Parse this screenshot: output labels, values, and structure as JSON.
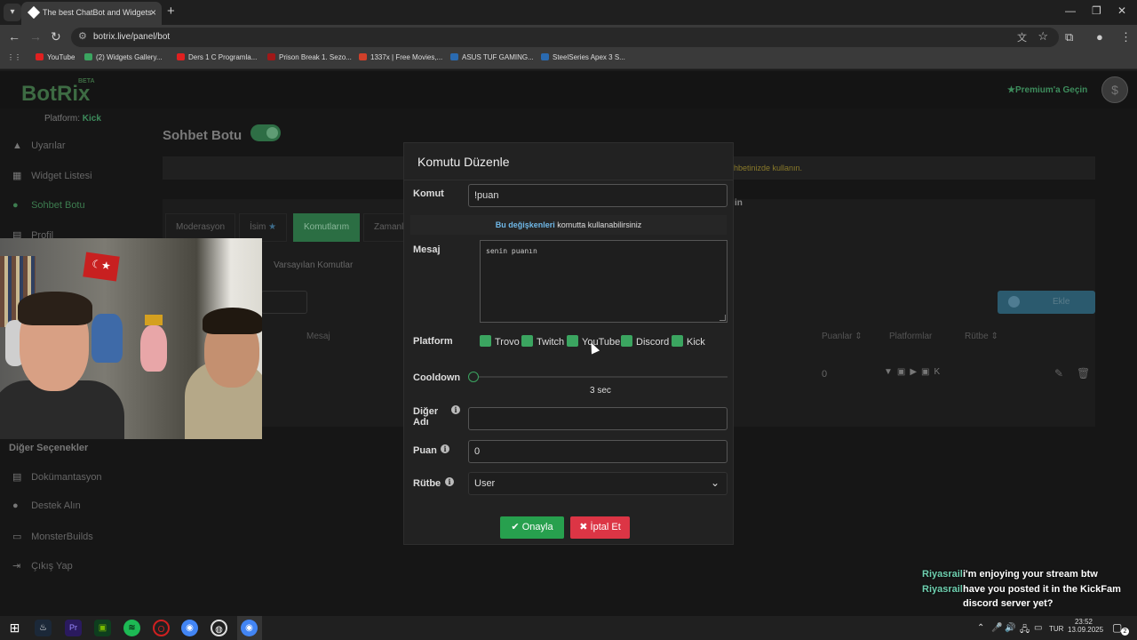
{
  "browser": {
    "tab_title": "The best ChatBot and Widgets",
    "url": "botrix.live/panel/bot",
    "bookmarks": [
      "YouTube",
      "(2) Widgets Gallery...",
      "Ders 1 C Programla...",
      "Prison Break 1. Sezo...",
      "1337x | Free Movies,...",
      "ASUS TUF GAMING...",
      "SteelSeries Apex 3 S..."
    ]
  },
  "app": {
    "logo": "BotRix",
    "beta": "BETA",
    "premium": "Premium'a Geçin",
    "platform_label": "Platform:",
    "platform_value": "Kick",
    "page_title": "Sohbet Botu",
    "info_text": "hbetinizde kullanın.",
    "peek_text": "in"
  },
  "sidebar": {
    "items": [
      "Uyarılar",
      "Widget Listesi",
      "Sohbet Botu",
      "Profil"
    ],
    "section_title": "Diğer Seçenekler",
    "other_items": [
      "Dokümantasyon",
      "Destek Alın",
      "MonsterBuilds",
      "Çıkış Yap"
    ]
  },
  "tabs": [
    "Moderasyon",
    "İsim",
    "Komutlarım",
    "Zamanl"
  ],
  "subtab": "Varsayılan Komutlar",
  "add_button": "Ekle",
  "table": {
    "headers": [
      "Mesaj",
      "Puanlar",
      "Platformlar",
      "Rütbe"
    ],
    "row_points": "0"
  },
  "modal": {
    "title": "Komutu Düzenle",
    "command_label": "Komut",
    "command_value": "!puan",
    "note_link": "Bu değişkenleri",
    "note_text": "komutta kullanabilirsiniz",
    "message_label": "Mesaj",
    "message_value": "senin puanın",
    "platform_label": "Platform",
    "platforms": [
      "Trovo",
      "Twitch",
      "YouTube",
      "Discord",
      "Kick"
    ],
    "cooldown_label": "Cooldown",
    "cooldown_value": "3 sec",
    "alias_label_1": "Diğer",
    "alias_label_2": "Adı",
    "alias_value": "",
    "points_label": "Puan",
    "points_value": "0",
    "rank_label": "Rütbe",
    "rank_value": "User",
    "confirm_label": "Onayla",
    "cancel_label": "İptal Et"
  },
  "chat": [
    {
      "user": "Riyasrail",
      "message": "i'm enjoying your stream btw"
    },
    {
      "user": "Riyasrail",
      "message": "have you posted it in the KickFam"
    },
    {
      "user": "",
      "message": "discord server yet?"
    }
  ],
  "taskbar": {
    "language": "TUR",
    "time": "23:52",
    "date": "13.09.2025",
    "notifications": "2"
  }
}
